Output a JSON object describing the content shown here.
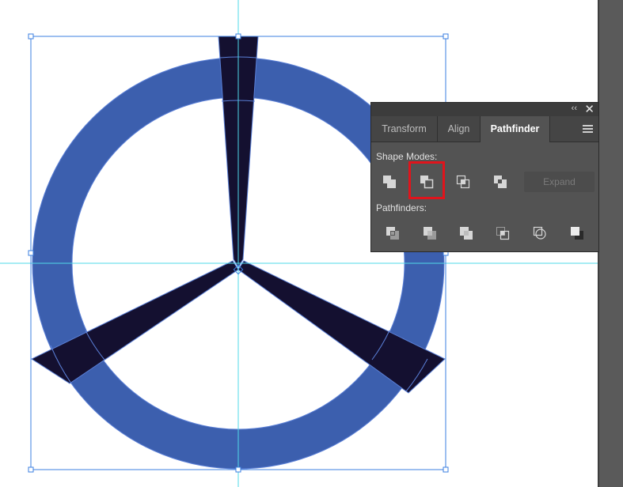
{
  "panel": {
    "collapse_glyph": "‹‹",
    "close_glyph": "✕",
    "tabs": [
      {
        "label": "Transform",
        "active": false
      },
      {
        "label": "Align",
        "active": false
      },
      {
        "label": "Pathfinder",
        "active": true
      }
    ],
    "shape_modes_label": "Shape Modes:",
    "pathfinders_label": "Pathfinders:",
    "expand_label": "Expand",
    "shape_mode_buttons": [
      "unite-icon",
      "minus-front-icon",
      "intersect-icon",
      "exclude-icon"
    ],
    "pathfinder_buttons": [
      "divide-icon",
      "trim-icon",
      "merge-icon",
      "crop-icon",
      "outline-icon",
      "minus-back-icon"
    ],
    "highlighted_button": "minus-front-icon"
  },
  "colors": {
    "ring": "#3c5fae",
    "spoke": "#141030",
    "guide": "#4fd8e8",
    "selection": "#3b7fe0",
    "highlight": "#e0141c"
  }
}
